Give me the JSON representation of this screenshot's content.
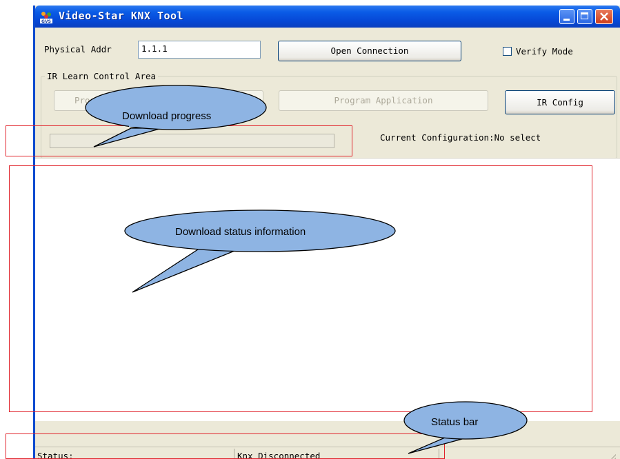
{
  "window": {
    "title": "Video-Star KNX Tool",
    "title_color": "#ffffff",
    "titlebar_color": "#0a5be6",
    "app_icon": "gvs-app-icon",
    "controls": [
      "minimize-icon",
      "maximize-icon",
      "close-icon"
    ]
  },
  "connection": {
    "physical_addr_label": "Physical Addr",
    "physical_addr_value": "1.1.1",
    "open_connection_label": "Open Connection",
    "verify_mode_label": "Verify Mode",
    "verify_mode_checked": false
  },
  "ir_area": {
    "group_title": "IR Learn Control Area",
    "program_button_label": "Prog",
    "program_application_label": "Program Application",
    "ir_config_label": "IR Config",
    "current_configuration_label": "Current Configuration:No select"
  },
  "statusbar": {
    "status_label": "Status:",
    "connection_status": "Knx Disconnected"
  },
  "annotations": {
    "color": "#e0222a",
    "bubble_fill": "#8eb4e3",
    "download_progress": "Download progress",
    "download_status": "Download status information",
    "status_bar": "Status bar"
  }
}
